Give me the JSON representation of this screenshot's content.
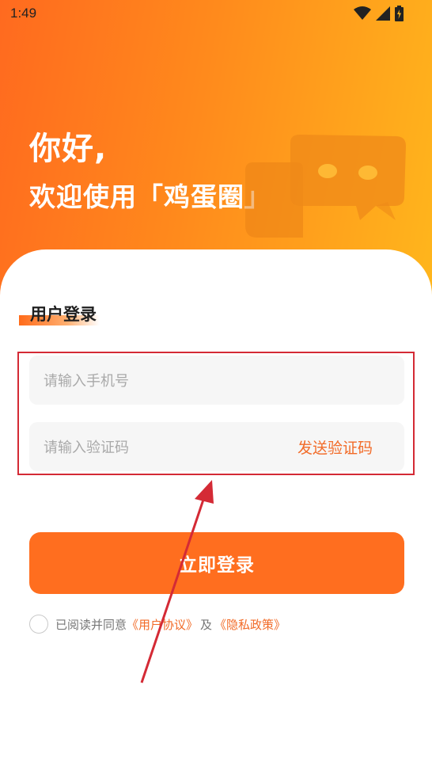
{
  "status_bar": {
    "time": "1:49",
    "icons": [
      "wifi-icon",
      "cellular-signal-icon",
      "battery-charging-icon"
    ]
  },
  "hero": {
    "greeting_line1": "你好,",
    "greeting_line2": "欢迎使用「鸡蛋圈」"
  },
  "login": {
    "section_title": "用户登录",
    "phone_placeholder": "请输入手机号",
    "code_placeholder": "请输入验证码",
    "send_code_label": "发送验证码",
    "submit_label": "立即登录"
  },
  "agreement": {
    "prefix": "已阅读并同意",
    "user_agreement": "《用户协议》",
    "connector": "及",
    "privacy_policy": "《隐私政策》"
  },
  "colors": {
    "accent": "#ff6e1f",
    "gradient_start": "#ff6a1f",
    "gradient_end": "#ffb61c",
    "link": "#f26b28",
    "annotation_red": "#d42a35",
    "input_bg": "#f6f6f6"
  }
}
